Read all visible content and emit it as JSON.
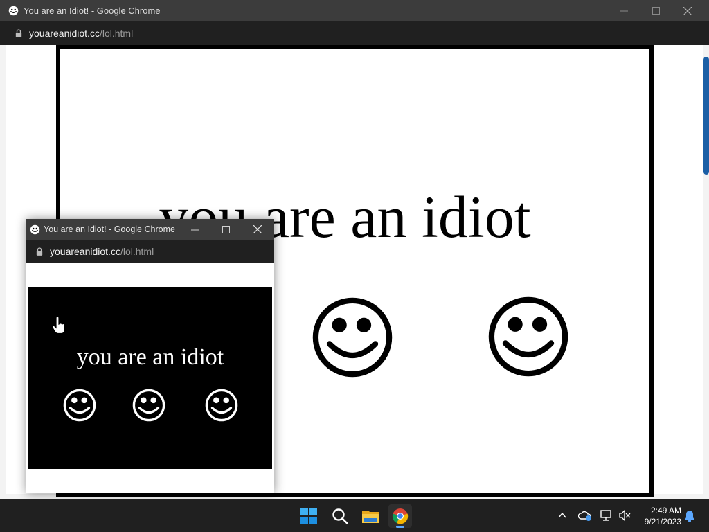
{
  "main_window": {
    "title": "You are an Idiot! - Google Chrome",
    "url_host": "youareanidiot.cc",
    "url_path": "/lol.html",
    "content_text": "you are an idiot"
  },
  "popup_window": {
    "title": "You are an Idiot! - Google Chrome",
    "url_host": "youareanidiot.cc",
    "url_path": "/lol.html",
    "content_text": "you are an idiot"
  },
  "taskbar": {
    "time": "2:49 AM",
    "date": "9/21/2023",
    "icons": [
      "windows-start-icon",
      "search-icon",
      "file-explorer-icon",
      "chrome-icon"
    ],
    "tray_icons": [
      "chevron-up-icon",
      "onedrive-icon",
      "network-icon",
      "volume-muted-icon",
      "notification-bell-icon"
    ]
  },
  "colors": {
    "titlebar": "#3c3c3c",
    "addressbar": "#202020",
    "taskbar": "#202020",
    "accent": "#0078d4"
  }
}
